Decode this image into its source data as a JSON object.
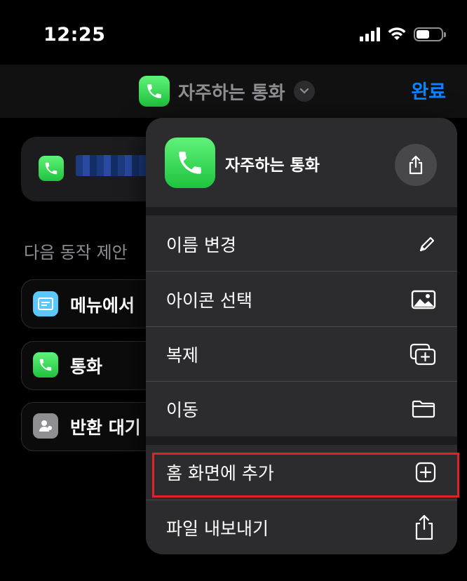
{
  "status_bar": {
    "time": "12:25"
  },
  "nav": {
    "title": "자주하는 통화",
    "done_label": "완료"
  },
  "background": {
    "section_label": "다음 동작 제안",
    "actions": [
      {
        "label": "메뉴에서"
      },
      {
        "label": "통화"
      },
      {
        "label": "반환 대기"
      }
    ]
  },
  "menu": {
    "header_title": "자주하는 통화",
    "items": [
      {
        "label": "이름 변경",
        "icon": "pencil-icon"
      },
      {
        "label": "아이콘 선택",
        "icon": "image-icon"
      },
      {
        "label": "복제",
        "icon": "duplicate-icon"
      },
      {
        "label": "이동",
        "icon": "folder-icon"
      },
      {
        "label": "홈 화면에 추가",
        "icon": "plus-square-icon"
      },
      {
        "label": "파일 내보내기",
        "icon": "share-icon"
      }
    ]
  },
  "colors": {
    "accent": "#0a84ff",
    "highlight": "#e0222b",
    "phone_green": "#30d158"
  }
}
